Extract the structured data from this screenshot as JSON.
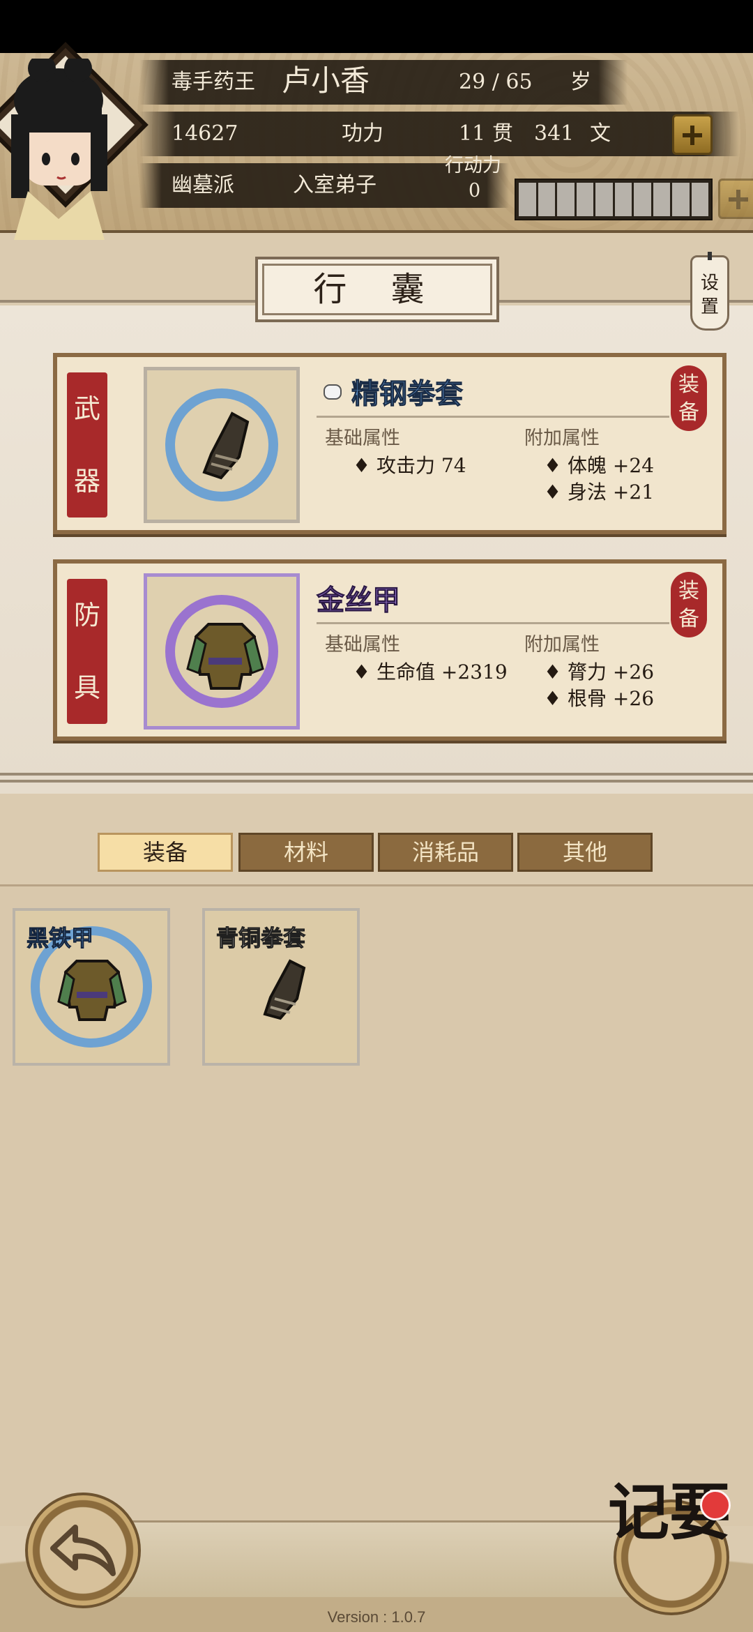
{
  "header": {
    "title_name": "毒手药王",
    "character_name": "卢小香",
    "age": "29 / 65",
    "age_unit": "岁",
    "power_value": "14627",
    "power_label": "功力",
    "money_guan": "11",
    "money_guan_unit": "贯",
    "money_wen": "341",
    "money_wen_unit": "文",
    "sect": "幽墓派",
    "rank": "入室弟子",
    "action_label": "行动力",
    "action_value": "0",
    "action_max_segments": 10,
    "action_filled_segments": 0
  },
  "page_title": "行 囊",
  "settings_label": "设置",
  "equipped": {
    "weapon": {
      "slot_label_top": "武",
      "slot_label_bottom": "器",
      "name": "精钢拳套",
      "base_label": "基础属性",
      "bonus_label": "附加属性",
      "base_stats": [
        "攻击力 74"
      ],
      "bonus_stats": [
        "体魄 +24",
        "身法 +21"
      ],
      "seal_top": "装",
      "seal_bottom": "备",
      "rarity_color": "#5b8fc7",
      "icon": "gauntlet-icon"
    },
    "armor": {
      "slot_label_top": "防",
      "slot_label_bottom": "具",
      "name": "金丝甲",
      "base_label": "基础属性",
      "bonus_label": "附加属性",
      "base_stats": [
        "生命值 +2319"
      ],
      "bonus_stats": [
        "膂力 +26",
        "根骨 +26"
      ],
      "seal_top": "装",
      "seal_bottom": "备",
      "rarity_color": "#9b79d4",
      "icon": "armor-icon"
    }
  },
  "tabs": [
    {
      "label": "装备",
      "active": true
    },
    {
      "label": "材料",
      "active": false
    },
    {
      "label": "消耗品",
      "active": false
    },
    {
      "label": "其他",
      "active": false
    }
  ],
  "inventory": [
    {
      "name": "黑铁甲",
      "rarity_color": "#6aa4dd",
      "icon": "armor-icon"
    },
    {
      "name": "青铜拳套",
      "rarity_color": "#f4efe4",
      "icon": "gauntlet-icon"
    }
  ],
  "memo_label": "记要",
  "version": "Version : 1.0.7",
  "colors": {
    "accent_red": "#a8292a",
    "frame_brown": "#8b6a44",
    "tab_active": "#f6dea6"
  }
}
